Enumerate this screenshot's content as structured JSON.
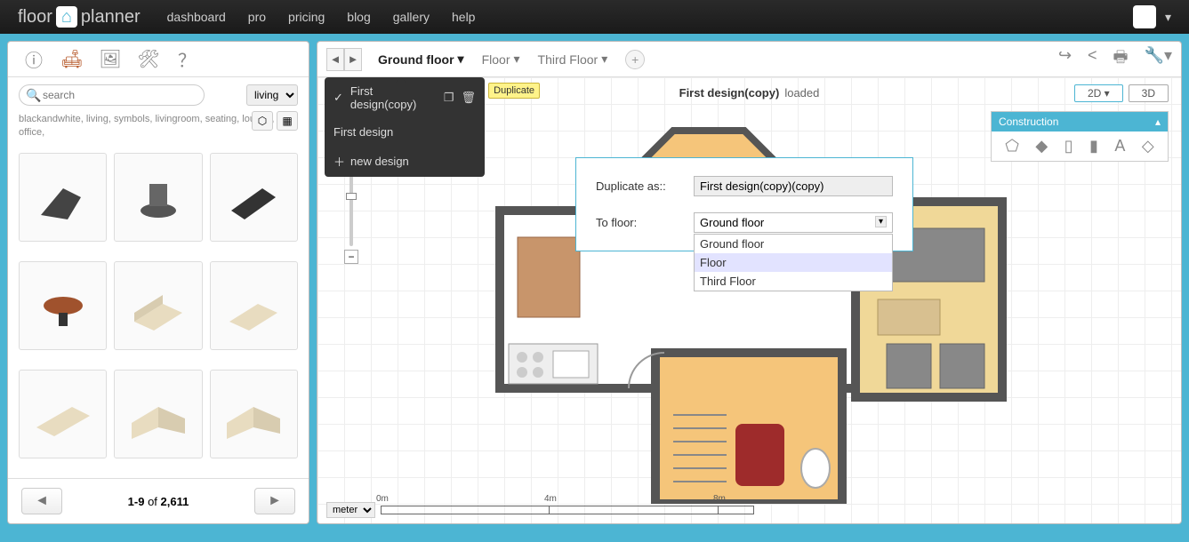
{
  "logo": {
    "part1": "floor",
    "part2": "planner"
  },
  "nav": {
    "dashboard": "dashboard",
    "pro": "pro",
    "pricing": "pricing",
    "blog": "blog",
    "gallery": "gallery",
    "help": "help"
  },
  "sidebar": {
    "search_placeholder": "search",
    "filter_value": "living",
    "tags": "blackandwhite, living, symbols, livingroom, seating, lounge, office,",
    "pager": {
      "range": "1-9",
      "of": "of",
      "total": "2,611"
    }
  },
  "floors": [
    {
      "label": "Ground floor",
      "active": true
    },
    {
      "label": "Floor",
      "active": false
    },
    {
      "label": "Third Floor",
      "active": false
    }
  ],
  "design_menu": {
    "items": [
      {
        "label": "First design(copy)",
        "active": true
      },
      {
        "label": "First design",
        "active": false
      }
    ],
    "new_label": "new design",
    "tooltip": "Duplicate"
  },
  "design_title": {
    "name": "First design(copy)",
    "status": "loaded"
  },
  "view": {
    "d2": "2D",
    "d3": "3D"
  },
  "construction": {
    "title": "Construction"
  },
  "dialog": {
    "duplicate_label": "Duplicate as::",
    "duplicate_value": "First design(copy)(copy)",
    "tofloor_label": "To floor:",
    "tofloor_value": "Ground floor",
    "options": [
      "Ground floor",
      "Floor",
      "Third Floor"
    ],
    "highlighted": "Floor"
  },
  "scale": {
    "unit": "meter",
    "marks": [
      "0m",
      "4m",
      "8m"
    ]
  }
}
